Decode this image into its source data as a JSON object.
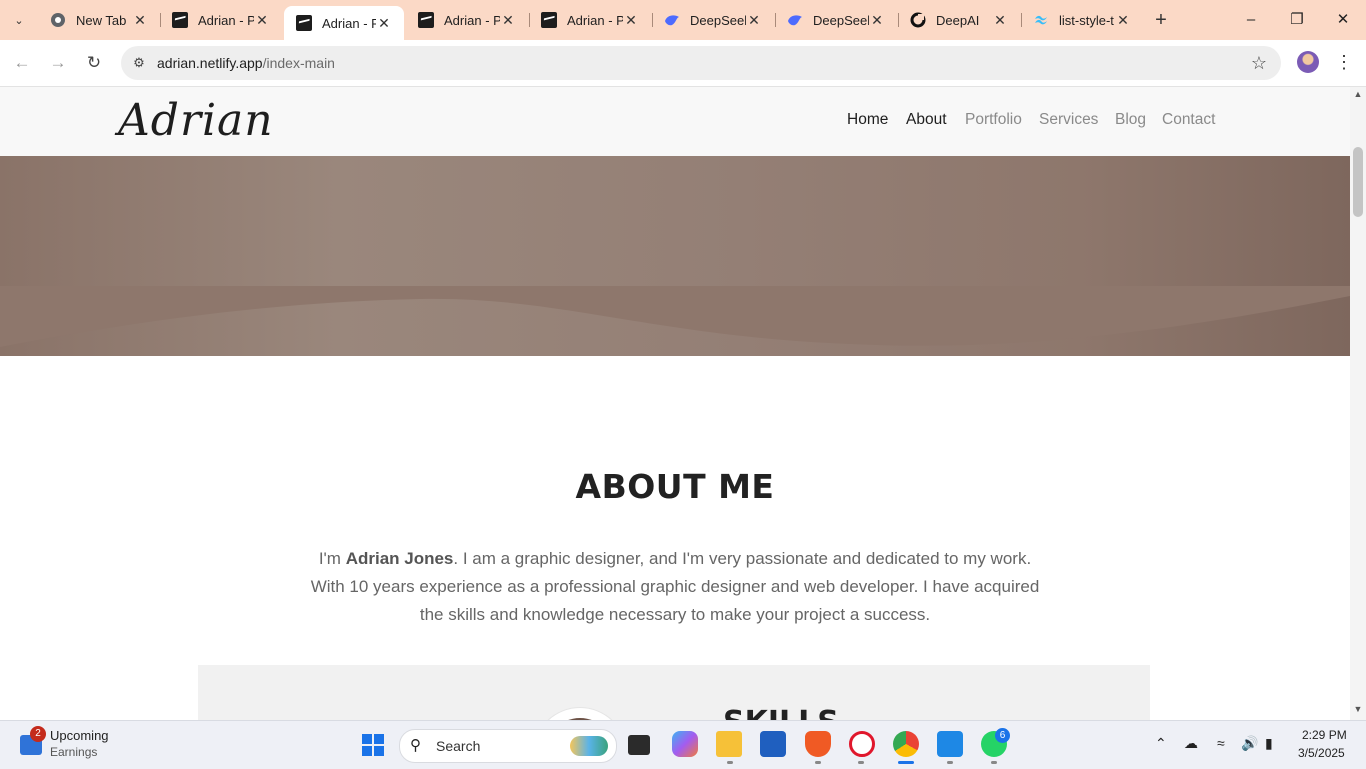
{
  "browser": {
    "tabs": [
      {
        "title": "New Tab",
        "favicon": "chrome-icon",
        "active": false
      },
      {
        "title": "Adrian - P",
        "favicon": "adrian-favicon",
        "active": false
      },
      {
        "title": "Adrian - P",
        "favicon": "adrian-favicon",
        "active": true
      },
      {
        "title": "Adrian - P",
        "favicon": "adrian-favicon",
        "active": false
      },
      {
        "title": "Adrian - P",
        "favicon": "adrian-favicon",
        "active": false
      },
      {
        "title": "DeepSeek",
        "favicon": "deepseek-icon",
        "active": false
      },
      {
        "title": "DeepSeek",
        "favicon": "deepseek-icon",
        "active": false
      },
      {
        "title": "DeepAI",
        "favicon": "deepai-icon",
        "active": false
      },
      {
        "title": "list-style-t",
        "favicon": "tailwind-icon",
        "active": false
      }
    ],
    "url_domain": "adrian.netlify.app",
    "url_path": "/index-main",
    "accent_color": "#fbd9c6"
  },
  "site": {
    "logo": "Adrian",
    "nav": [
      "Home",
      "About",
      "Portfolio",
      "Services",
      "Blog",
      "Contact"
    ],
    "about": {
      "title": "ABOUT ME",
      "intro_prefix": "I'm ",
      "name": "Adrian Jones",
      "intro_rest": ". I am a graphic designer, and I'm very passionate and dedicated to my work. With 10 years experience as a professional graphic designer and web developer. I have acquired the skills and knowledge necessary to make your project a success."
    },
    "skills_title": "SKILLS"
  },
  "taskbar": {
    "widget_title": "Upcoming",
    "widget_sub": "Earnings",
    "widget_badge": "2",
    "search_placeholder": "Search",
    "whatsapp_badge": "6",
    "time": "2:29 PM",
    "date": "3/5/2025"
  }
}
